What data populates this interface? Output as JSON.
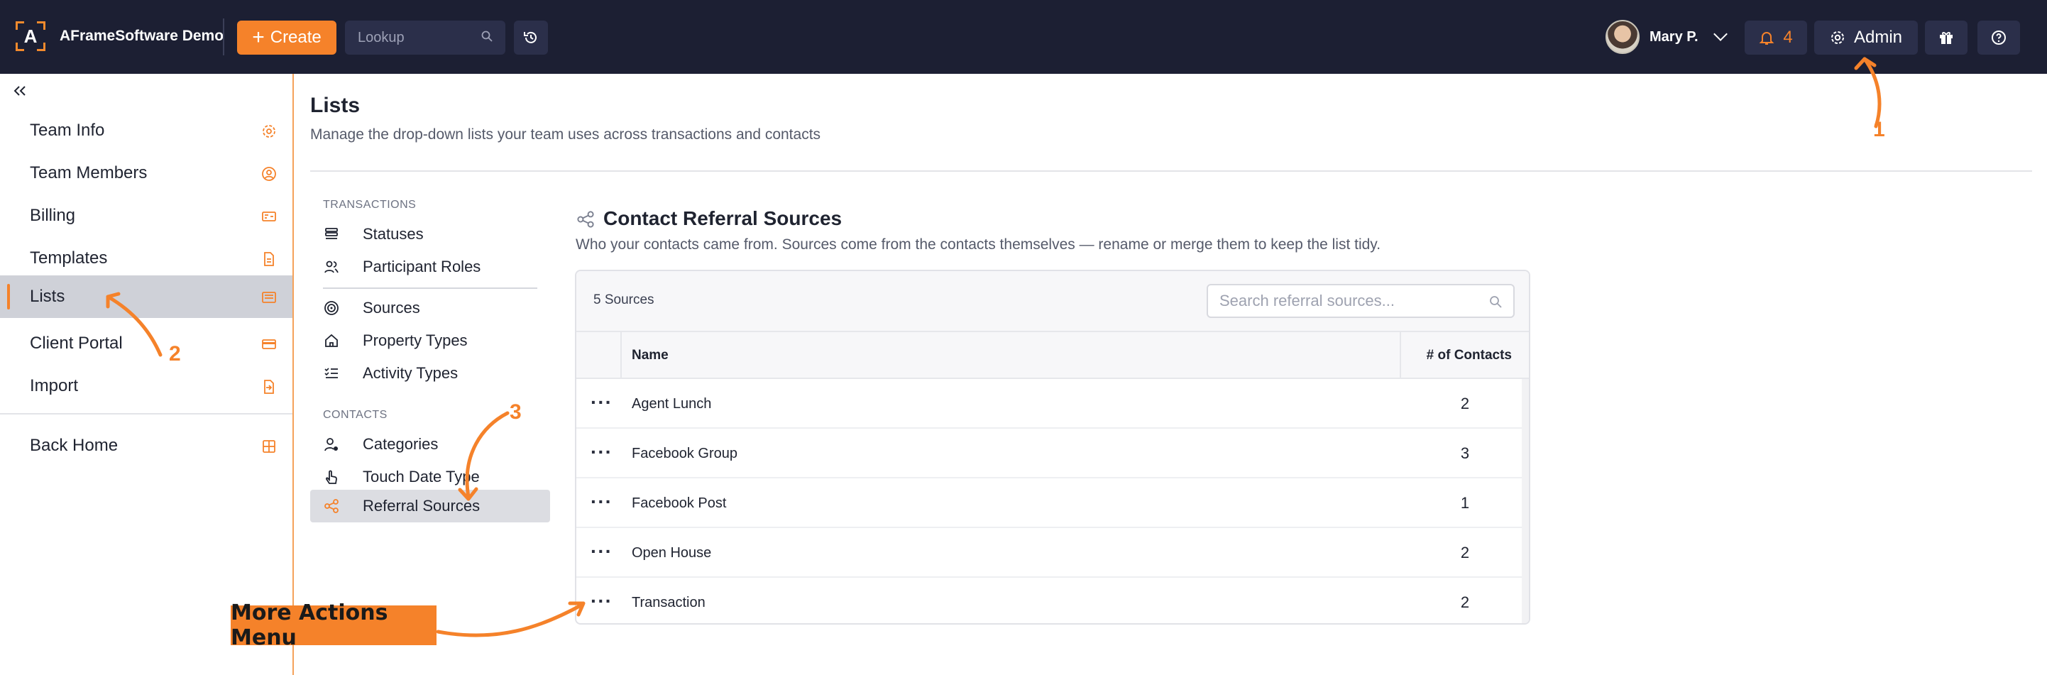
{
  "topbar": {
    "brand_name": "AFrameSoftware Demo",
    "logo_letter": "A",
    "create_label": "Create",
    "lookup_placeholder": "Lookup",
    "user_name": "Mary P.",
    "notifications_count": "4",
    "admin_label": "Admin"
  },
  "sidebar": {
    "items": [
      {
        "label": "Team Info",
        "icon": "gear-icon"
      },
      {
        "label": "Team Members",
        "icon": "user-circle-icon"
      },
      {
        "label": "Billing",
        "icon": "billing-icon"
      },
      {
        "label": "Templates",
        "icon": "document-icon"
      },
      {
        "label": "Lists",
        "icon": "list-icon",
        "active": true
      },
      {
        "label": "Client Portal",
        "icon": "card-icon"
      },
      {
        "label": "Import",
        "icon": "import-icon"
      }
    ],
    "back_home": {
      "label": "Back Home",
      "icon": "grid-icon"
    }
  },
  "page": {
    "title": "Lists",
    "subtitle": "Manage the drop-down lists your team uses across transactions and contacts"
  },
  "subnav": {
    "transactions_heading": "TRANSACTIONS",
    "transactions": [
      "Statuses",
      "Participant Roles",
      "Sources",
      "Property Types",
      "Activity Types"
    ],
    "contacts_heading": "CONTACTS",
    "contacts": [
      "Categories",
      "Touch Date Type",
      "Referral Sources"
    ],
    "active": "Referral Sources"
  },
  "section": {
    "title": "Contact Referral Sources",
    "description": "Who your contacts came from. Sources come from the contacts themselves — rename or merge them to keep the list tidy.",
    "count_label": "5 Sources",
    "search_placeholder": "Search referral sources...",
    "columns": {
      "name": "Name",
      "count": "# of Contacts"
    },
    "rows": [
      {
        "name": "Agent Lunch",
        "count": "2"
      },
      {
        "name": "Facebook Group",
        "count": "3"
      },
      {
        "name": "Facebook Post",
        "count": "1"
      },
      {
        "name": "Open House",
        "count": "2"
      },
      {
        "name": "Transaction",
        "count": "2"
      }
    ]
  },
  "annotations": {
    "marker_1": "1",
    "marker_2": "2",
    "marker_3": "3",
    "more_actions_label": "More Actions Menu"
  },
  "colors": {
    "accent": "#f5822a",
    "topbar_bg": "#1c1f33",
    "active_bg": "#cfd1d8"
  }
}
